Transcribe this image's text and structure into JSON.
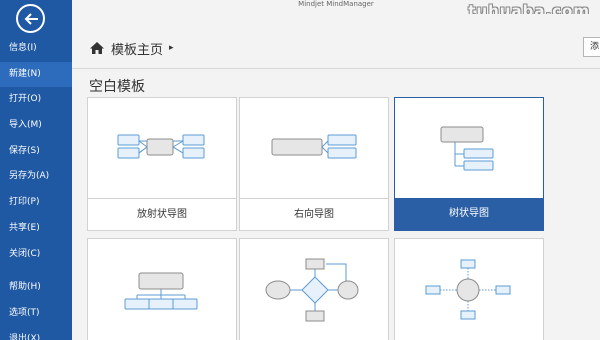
{
  "app": {
    "title": "Mindjet MindManager"
  },
  "watermark": "tuhuaba.com",
  "sidebar": {
    "back_icon": "arrow-left-icon",
    "items": [
      {
        "label": "信息(I)"
      },
      {
        "label": "新建(N)",
        "active": true
      },
      {
        "label": "打开(O)"
      },
      {
        "label": "导入(M)"
      },
      {
        "label": "保存(S)"
      },
      {
        "label": "另存为(A)"
      },
      {
        "label": "打印(P)"
      },
      {
        "label": "共享(E)"
      },
      {
        "label": "关闭(C)"
      },
      {
        "label": "帮助(H)"
      },
      {
        "label": "选项(T)"
      },
      {
        "label": "退出(X)"
      }
    ]
  },
  "breadcrumb": {
    "icon": "home-icon",
    "label": "模板主页",
    "arrow": "▸"
  },
  "side_button": {
    "label": "添"
  },
  "section": {
    "title": "空白模板"
  },
  "templates": [
    {
      "label": "放射状导图",
      "icon": "radial-map-icon",
      "selected": false
    },
    {
      "label": "右向导图",
      "icon": "right-map-icon",
      "selected": false
    },
    {
      "label": "树状导图",
      "icon": "tree-map-icon",
      "selected": true
    },
    {
      "label": "",
      "icon": "org-chart-icon",
      "selected": false
    },
    {
      "label": "",
      "icon": "flowchart-icon",
      "selected": false
    },
    {
      "label": "",
      "icon": "concept-map-icon",
      "selected": false
    }
  ],
  "colors": {
    "sidebar": "#1f58a3",
    "selected": "#2a5fa5",
    "node_fill": "#e6f1fb",
    "node_stroke": "#5b9bd5",
    "center_fill": "#e6e6e6"
  }
}
